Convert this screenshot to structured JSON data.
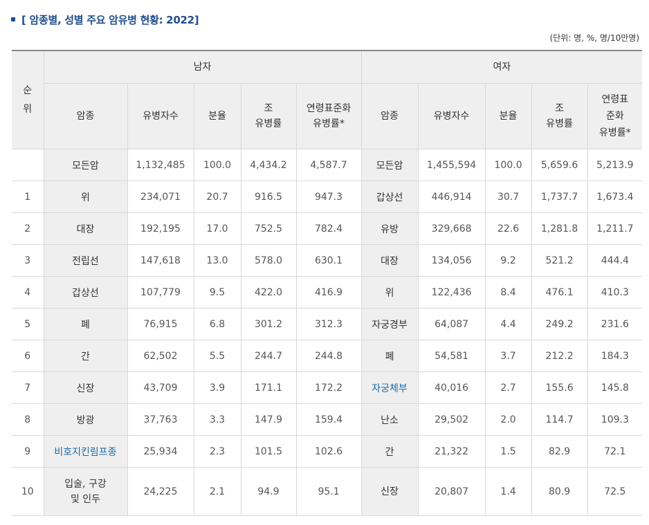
{
  "title": "[ 암종별, 성별 주요 암유병 현황: 2022]",
  "unit_note": "(단위: 명, %, 명/10만명)",
  "headers": {
    "rank": "순위",
    "male": "남자",
    "female": "여자",
    "cancer": "암종",
    "patients": "유병자수",
    "share": "분율",
    "crude_rate": "조\n유병률",
    "age_std_male": "연령표준화\n유병률*",
    "age_std_female": "연령표\n준화\n유병률*"
  },
  "rows": [
    {
      "rank": "",
      "m_name": "모든암",
      "m_count": "1,132,485",
      "m_share": "100.0",
      "m_crude": "4,434.2",
      "m_asr": "4,587.7",
      "f_name": "모든암",
      "f_count": "1,455,594",
      "f_share": "100.0",
      "f_crude": "5,659.6",
      "f_asr": "5,213.9"
    },
    {
      "rank": "1",
      "m_name": "위",
      "m_count": "234,071",
      "m_share": "20.7",
      "m_crude": "916.5",
      "m_asr": "947.3",
      "f_name": "갑상선",
      "f_count": "446,914",
      "f_share": "30.7",
      "f_crude": "1,737.7",
      "f_asr": "1,673.4"
    },
    {
      "rank": "2",
      "m_name": "대장",
      "m_count": "192,195",
      "m_share": "17.0",
      "m_crude": "752.5",
      "m_asr": "782.4",
      "f_name": "유방",
      "f_count": "329,668",
      "f_share": "22.6",
      "f_crude": "1,281.8",
      "f_asr": "1,211.7"
    },
    {
      "rank": "3",
      "m_name": "전립선",
      "m_count": "147,618",
      "m_share": "13.0",
      "m_crude": "578.0",
      "m_asr": "630.1",
      "f_name": "대장",
      "f_count": "134,056",
      "f_share": "9.2",
      "f_crude": "521.2",
      "f_asr": "444.4"
    },
    {
      "rank": "4",
      "m_name": "갑상선",
      "m_count": "107,779",
      "m_share": "9.5",
      "m_crude": "422.0",
      "m_asr": "416.9",
      "f_name": "위",
      "f_count": "122,436",
      "f_share": "8.4",
      "f_crude": "476.1",
      "f_asr": "410.3"
    },
    {
      "rank": "5",
      "m_name": "폐",
      "m_count": "76,915",
      "m_share": "6.8",
      "m_crude": "301.2",
      "m_asr": "312.3",
      "f_name": "자궁경부",
      "f_count": "64,087",
      "f_share": "4.4",
      "f_crude": "249.2",
      "f_asr": "231.6"
    },
    {
      "rank": "6",
      "m_name": "간",
      "m_count": "62,502",
      "m_share": "5.5",
      "m_crude": "244.7",
      "m_asr": "244.8",
      "f_name": "폐",
      "f_count": "54,581",
      "f_share": "3.7",
      "f_crude": "212.2",
      "f_asr": "184.3"
    },
    {
      "rank": "7",
      "m_name": "신장",
      "m_count": "43,709",
      "m_share": "3.9",
      "m_crude": "171.1",
      "m_asr": "172.2",
      "f_name": "자궁체부",
      "f_count": "40,016",
      "f_share": "2.7",
      "f_crude": "155.6",
      "f_asr": "145.8"
    },
    {
      "rank": "8",
      "m_name": "방광",
      "m_count": "37,763",
      "m_share": "3.3",
      "m_crude": "147.9",
      "m_asr": "159.4",
      "f_name": "난소",
      "f_count": "29,502",
      "f_share": "2.0",
      "f_crude": "114.7",
      "f_asr": "109.3"
    },
    {
      "rank": "9",
      "m_name": "비호지킨림프종",
      "m_count": "25,934",
      "m_share": "2.3",
      "m_crude": "101.5",
      "m_asr": "102.6",
      "f_name": "간",
      "f_count": "21,322",
      "f_share": "1.5",
      "f_crude": "82.9",
      "f_asr": "72.1"
    },
    {
      "rank": "10",
      "m_name": "입술, 구강\n및 인두",
      "m_count": "24,225",
      "m_share": "2.1",
      "m_crude": "94.9",
      "m_asr": "95.1",
      "f_name": "신장",
      "f_count": "20,807",
      "f_share": "1.4",
      "f_crude": "80.9",
      "f_asr": "72.5"
    }
  ],
  "link_color": "#1a6aa8",
  "title_color": "#1f4e8c"
}
